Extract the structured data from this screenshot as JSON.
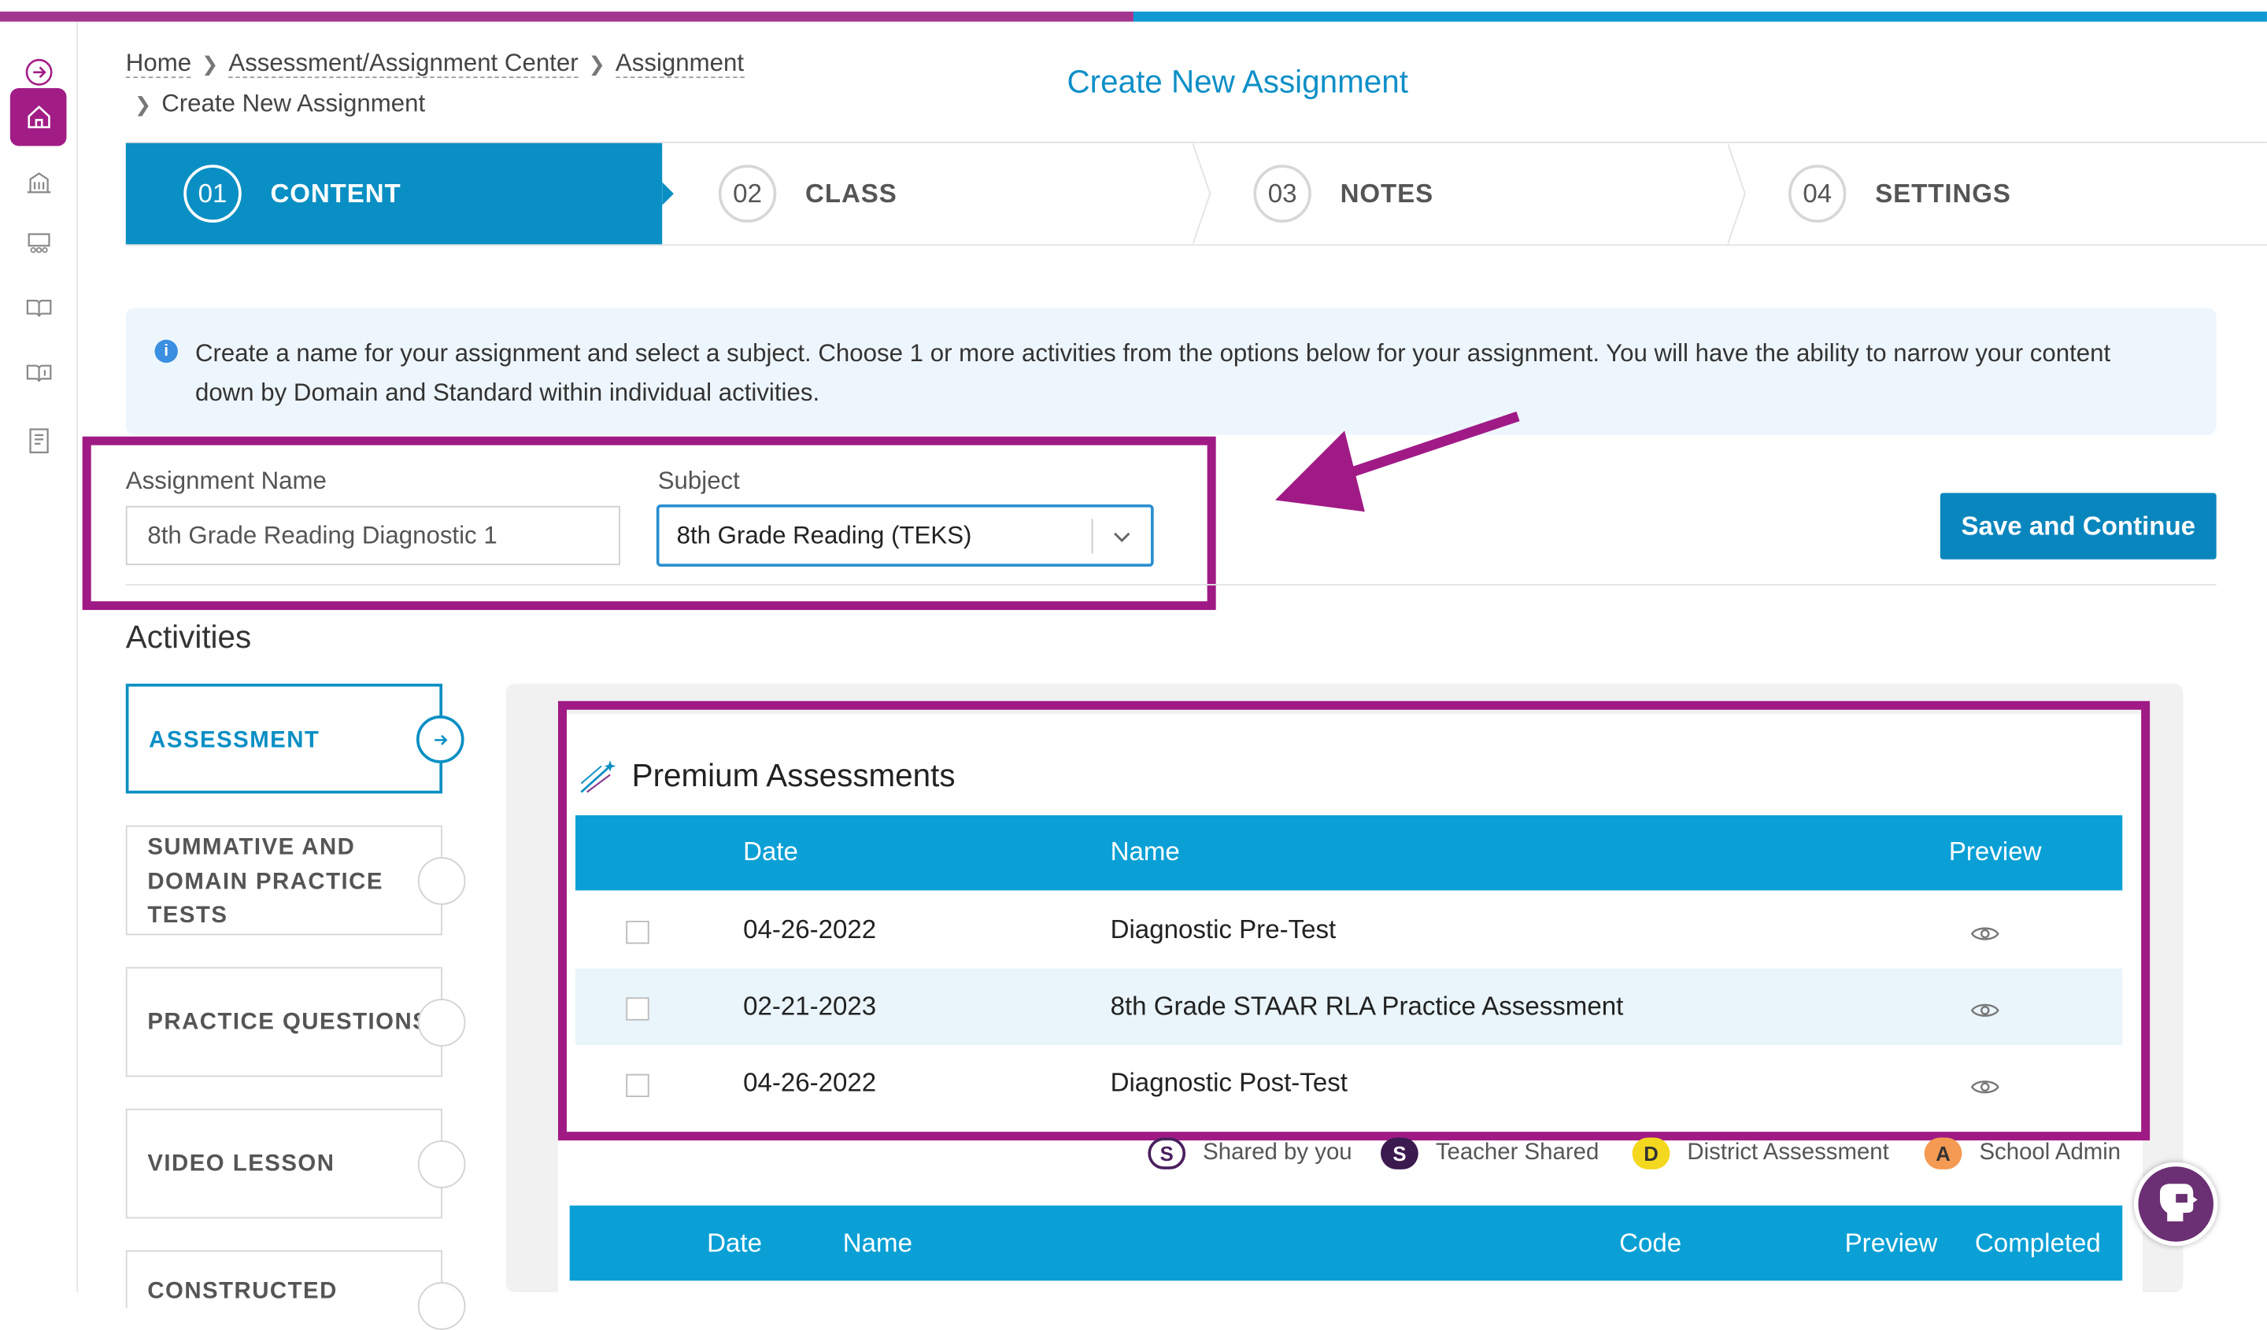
{
  "breadcrumb": {
    "home": "Home",
    "center": "Assessment/Assignment Center",
    "assignment": "Assignment",
    "current": "Create New Assignment"
  },
  "page_title": "Create New Assignment",
  "steps": [
    {
      "num": "01",
      "label": "CONTENT"
    },
    {
      "num": "02",
      "label": "CLASS"
    },
    {
      "num": "03",
      "label": "NOTES"
    },
    {
      "num": "04",
      "label": "SETTINGS"
    }
  ],
  "info_text": "Create a name for your assignment and select a subject. Choose 1 or more activities from the options below for your assignment. You will have the ability to narrow your content down by Domain and Standard within individual activities.",
  "form": {
    "name_label": "Assignment Name",
    "name_value": "8th Grade Reading Diagnostic 1",
    "subject_label": "Subject",
    "subject_value": "8th Grade Reading (TEKS)"
  },
  "save_label": "Save and Continue",
  "activities_title": "Activities",
  "activities": [
    {
      "label": "ASSESSMENT"
    },
    {
      "label": "SUMMATIVE AND DOMAIN PRACTICE TESTS"
    },
    {
      "label": "PRACTICE QUESTIONS"
    },
    {
      "label": "VIDEO LESSON"
    },
    {
      "label": "CONSTRUCTED"
    }
  ],
  "premium": {
    "title": "Premium Assessments",
    "columns": {
      "date": "Date",
      "name": "Name",
      "preview": "Preview"
    },
    "rows": [
      {
        "date": "04-26-2022",
        "name": "Diagnostic Pre-Test"
      },
      {
        "date": "02-21-2023",
        "name": "8th Grade STAAR RLA Practice Assessment"
      },
      {
        "date": "04-26-2022",
        "name": "Diagnostic Post-Test"
      }
    ]
  },
  "legend": [
    {
      "badge": "S",
      "label": "Shared by you"
    },
    {
      "badge": "S",
      "label": "Teacher Shared"
    },
    {
      "badge": "D",
      "label": "District Assessment"
    },
    {
      "badge": "A",
      "label": "School Admin"
    }
  ],
  "second_table": {
    "columns": {
      "date": "Date",
      "name": "Name",
      "code": "Code",
      "preview": "Preview",
      "completed": "Completed"
    }
  },
  "colors": {
    "brand_purple": "#a21c86",
    "brand_blue": "#0a8fc4",
    "table_header": "#0aa0d6"
  }
}
